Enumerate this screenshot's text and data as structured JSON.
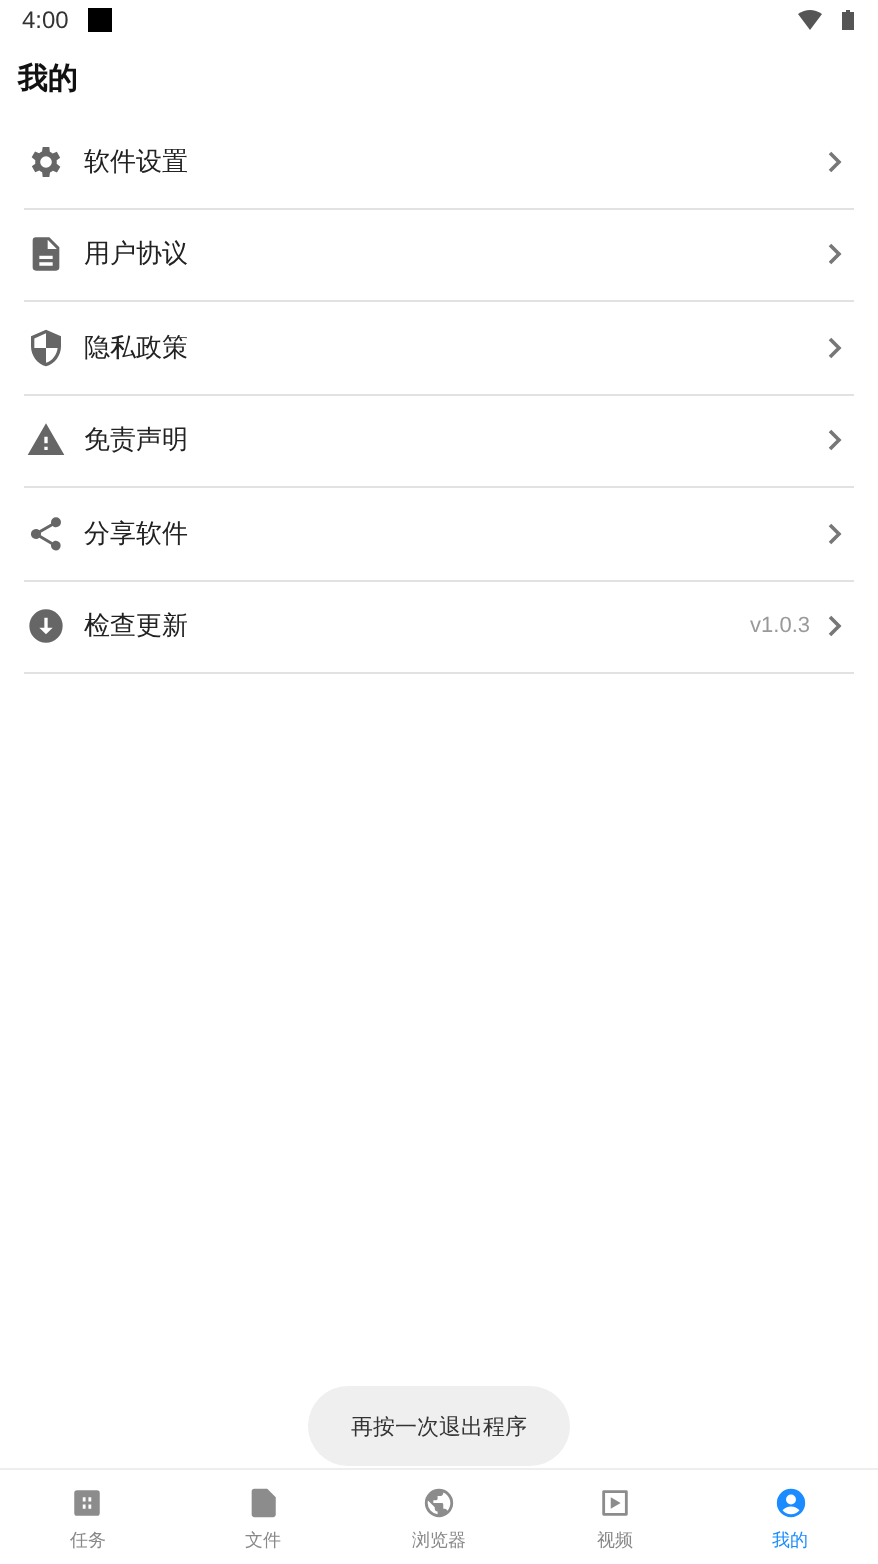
{
  "status_bar": {
    "time": "4:00"
  },
  "header": {
    "title": "我的"
  },
  "menu": [
    {
      "kind": "settings",
      "label": "软件设置"
    },
    {
      "kind": "document",
      "label": "用户协议"
    },
    {
      "kind": "shield",
      "label": "隐私政策"
    },
    {
      "kind": "warning",
      "label": "免责声明"
    },
    {
      "kind": "share",
      "label": "分享软件"
    },
    {
      "kind": "update",
      "label": "检查更新",
      "detail": "v1.0.3"
    }
  ],
  "toast": "再按一次退出程序",
  "bottom_nav": [
    {
      "kind": "tasks",
      "label": "任务",
      "selected": false
    },
    {
      "kind": "files",
      "label": "文件",
      "selected": false
    },
    {
      "kind": "browser",
      "label": "浏览器",
      "selected": false
    },
    {
      "kind": "video",
      "label": "视频",
      "selected": false
    },
    {
      "kind": "profile",
      "label": "我的",
      "selected": true
    }
  ]
}
